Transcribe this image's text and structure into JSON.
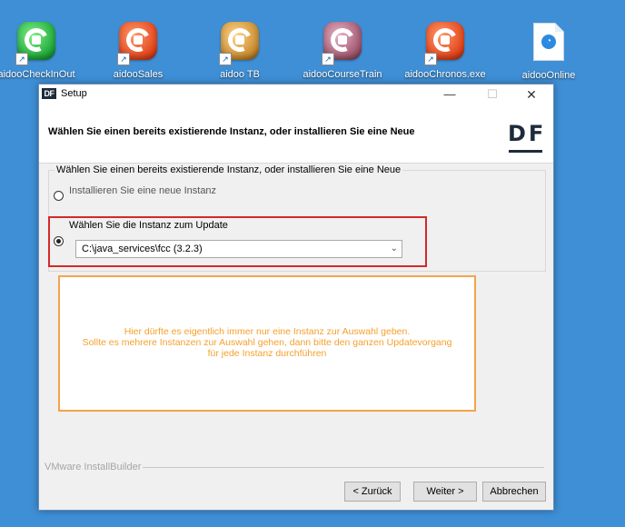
{
  "desktop": {
    "icons": [
      {
        "label": "aidooCheckInOut",
        "icon": "aidoo-green-icon"
      },
      {
        "label": "aidooSales",
        "icon": "aidoo-red-icon"
      },
      {
        "label": "aidoo TB",
        "icon": "aidoo-gold-icon"
      },
      {
        "label": "aidooCourseTrain",
        "icon": "aidoo-mauve-icon"
      },
      {
        "label": "aidooChronos.exe",
        "icon": "aidoo-red-icon"
      },
      {
        "label": "aidooOnline",
        "icon": "document-icon"
      }
    ]
  },
  "window": {
    "logo": "DF",
    "title": "Setup",
    "header_text": "Wählen Sie einen bereits existierende Instanz, oder installieren Sie eine Neue",
    "brand": "DF",
    "group_legend": "Wählen Sie einen bereits existierende Instanz, oder installieren Sie eine Neue",
    "option_new": "Installieren Sie eine neue Instanz",
    "option_update": "Wählen Sie die Instanz zum Update",
    "instance_selected": "C:\\java_services\\fcc (3.2.3)",
    "note_lines": [
      "Hier dürfte es eigentlich immer nur eine Instanz zur Auswahl geben.",
      "Sollte es mehrere Instanzen zur Auswahl gehen, dann bitte den ganzen Updatevorgang",
      "für jede Instanz durchführen"
    ],
    "footer_brand": "VMware InstallBuilder",
    "buttons": {
      "back": "< Zurück",
      "next": "Weiter >",
      "cancel": "Abbrechen"
    }
  },
  "colors": {
    "desktop": "#3f8fd6",
    "highlight": "#d22a2a",
    "note": "#f5a02c"
  }
}
